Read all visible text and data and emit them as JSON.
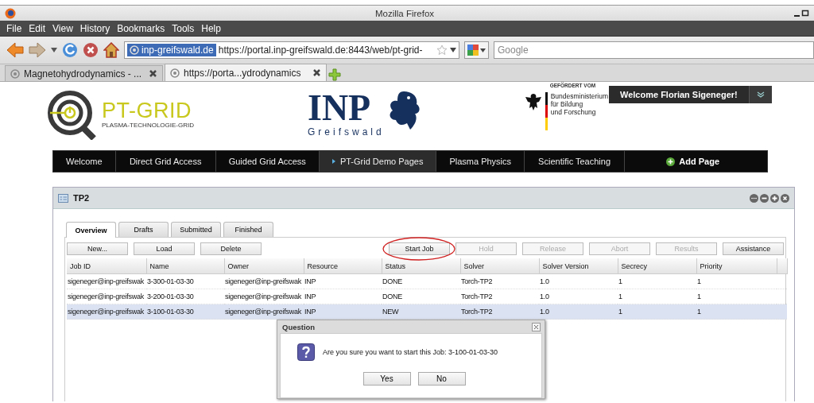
{
  "window": {
    "title": "Mozilla Firefox"
  },
  "menu": [
    "File",
    "Edit",
    "View",
    "History",
    "Bookmarks",
    "Tools",
    "Help"
  ],
  "address_bar": {
    "site_identity": "inp-greifswald.de",
    "url": "https://portal.inp-greifswald.de:8443/web/pt-grid-"
  },
  "search": {
    "placeholder": "Google"
  },
  "browser_tabs": [
    {
      "label": "Magnetohydrodynamics - ...",
      "selected": false
    },
    {
      "label": "https://porta...ydrodynamics",
      "selected": true
    }
  ],
  "header": {
    "logo_title": "PT-GRID",
    "logo_subtitle": "PLASMA-TECHNOLOGIE-GRID",
    "inp_title": "INP",
    "inp_subtitle": "Greifswald",
    "sponsor_caption": "GEFÖRDERT VOM",
    "sponsor_lines": [
      "Bundesministerium",
      "für Bildung",
      "und Forschung"
    ],
    "welcome": "Welcome Florian Sigeneger!"
  },
  "nav": {
    "items": [
      {
        "label": "Welcome",
        "selected": false
      },
      {
        "label": "Direct Grid Access",
        "selected": false
      },
      {
        "label": "Guided Grid Access",
        "selected": false
      },
      {
        "label": "PT-Grid Demo Pages",
        "selected": true
      },
      {
        "label": "Plasma Physics",
        "selected": false
      },
      {
        "label": "Scientific Teaching",
        "selected": false
      }
    ],
    "add_page": "Add Page"
  },
  "portlet": {
    "title": "TP2",
    "tabs": [
      {
        "label": "Overview",
        "selected": true
      },
      {
        "label": "Drafts",
        "selected": false
      },
      {
        "label": "Submitted",
        "selected": false
      },
      {
        "label": "Finished",
        "selected": false
      }
    ],
    "buttons": [
      {
        "label": "New...",
        "disabled": false,
        "highlighted": false
      },
      {
        "label": "Load",
        "disabled": false,
        "highlighted": false
      },
      {
        "label": "Delete",
        "disabled": false,
        "highlighted": false
      },
      {
        "label": "Start Job",
        "disabled": false,
        "highlighted": true
      },
      {
        "label": "Hold",
        "disabled": true,
        "highlighted": false
      },
      {
        "label": "Release",
        "disabled": true,
        "highlighted": false
      },
      {
        "label": "Abort",
        "disabled": true,
        "highlighted": false
      },
      {
        "label": "Results",
        "disabled": true,
        "highlighted": false
      },
      {
        "label": "Assistance",
        "disabled": false,
        "highlighted": false
      }
    ],
    "table": {
      "columns": [
        "Job ID",
        "Name",
        "Owner",
        "Resource",
        "Status",
        "Solver",
        "Solver Version",
        "Secrecy",
        "Priority"
      ],
      "rows": [
        {
          "cells": [
            "sigeneger@inp-greifswak",
            "3-300-01-03-30",
            "sigeneger@inp-greifswak",
            "INP",
            "DONE",
            "Torch-TP2",
            "1.0",
            "1",
            "1"
          ],
          "selected": false
        },
        {
          "cells": [
            "sigeneger@inp-greifswak",
            "3-200-01-03-30",
            "sigeneger@inp-greifswak",
            "INP",
            "DONE",
            "Torch-TP2",
            "1.0",
            "1",
            "1"
          ],
          "selected": false
        },
        {
          "cells": [
            "sigeneger@inp-greifswak",
            "3-100-01-03-30",
            "sigeneger@inp-greifswak",
            "INP",
            "NEW",
            "Torch-TP2",
            "1.0",
            "1",
            "1"
          ],
          "selected": true
        }
      ]
    }
  },
  "dialog": {
    "title": "Question",
    "message": "Are you sure you want to start this Job: 3-100-01-03-30",
    "buttons": [
      "Yes",
      "No"
    ]
  }
}
